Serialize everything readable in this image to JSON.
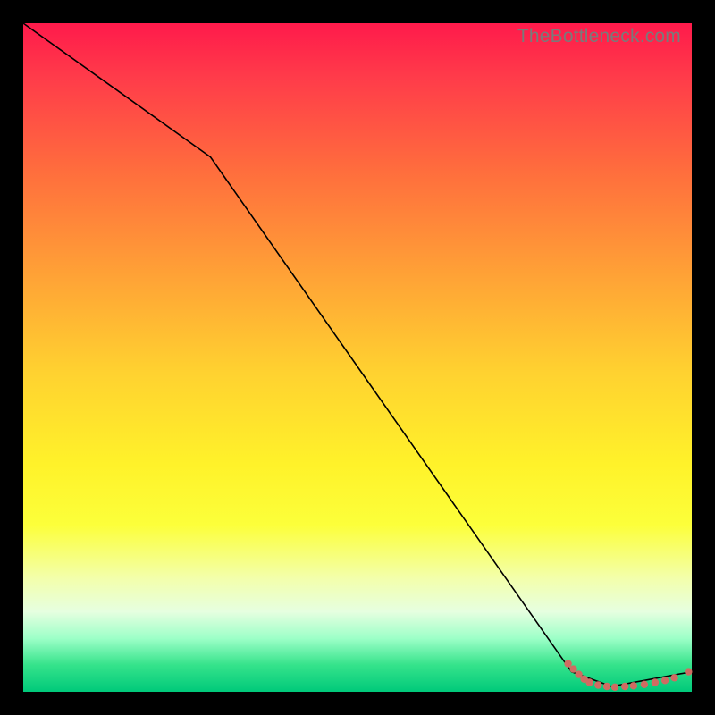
{
  "watermark": "TheBottleneck.com",
  "chart_data": {
    "type": "line",
    "title": "",
    "xlabel": "",
    "ylabel": "",
    "xlim": [
      0,
      100
    ],
    "ylim": [
      0,
      100
    ],
    "grid": false,
    "series": [
      {
        "name": "curve",
        "x": [
          0,
          28,
          82,
          88,
          100
        ],
        "y": [
          100,
          80,
          3,
          0.8,
          3
        ]
      }
    ],
    "markers": [
      {
        "x": 81.5,
        "y": 4.2
      },
      {
        "x": 82.3,
        "y": 3.4
      },
      {
        "x": 83.1,
        "y": 2.6
      },
      {
        "x": 83.9,
        "y": 1.9
      },
      {
        "x": 84.7,
        "y": 1.4
      },
      {
        "x": 86.0,
        "y": 1.0
      },
      {
        "x": 87.3,
        "y": 0.8
      },
      {
        "x": 88.5,
        "y": 0.7
      },
      {
        "x": 90.0,
        "y": 0.8
      },
      {
        "x": 91.3,
        "y": 0.9
      },
      {
        "x": 92.9,
        "y": 1.1
      },
      {
        "x": 94.5,
        "y": 1.4
      },
      {
        "x": 96.0,
        "y": 1.7
      },
      {
        "x": 97.4,
        "y": 2.1
      },
      {
        "x": 99.5,
        "y": 3.0
      }
    ]
  }
}
